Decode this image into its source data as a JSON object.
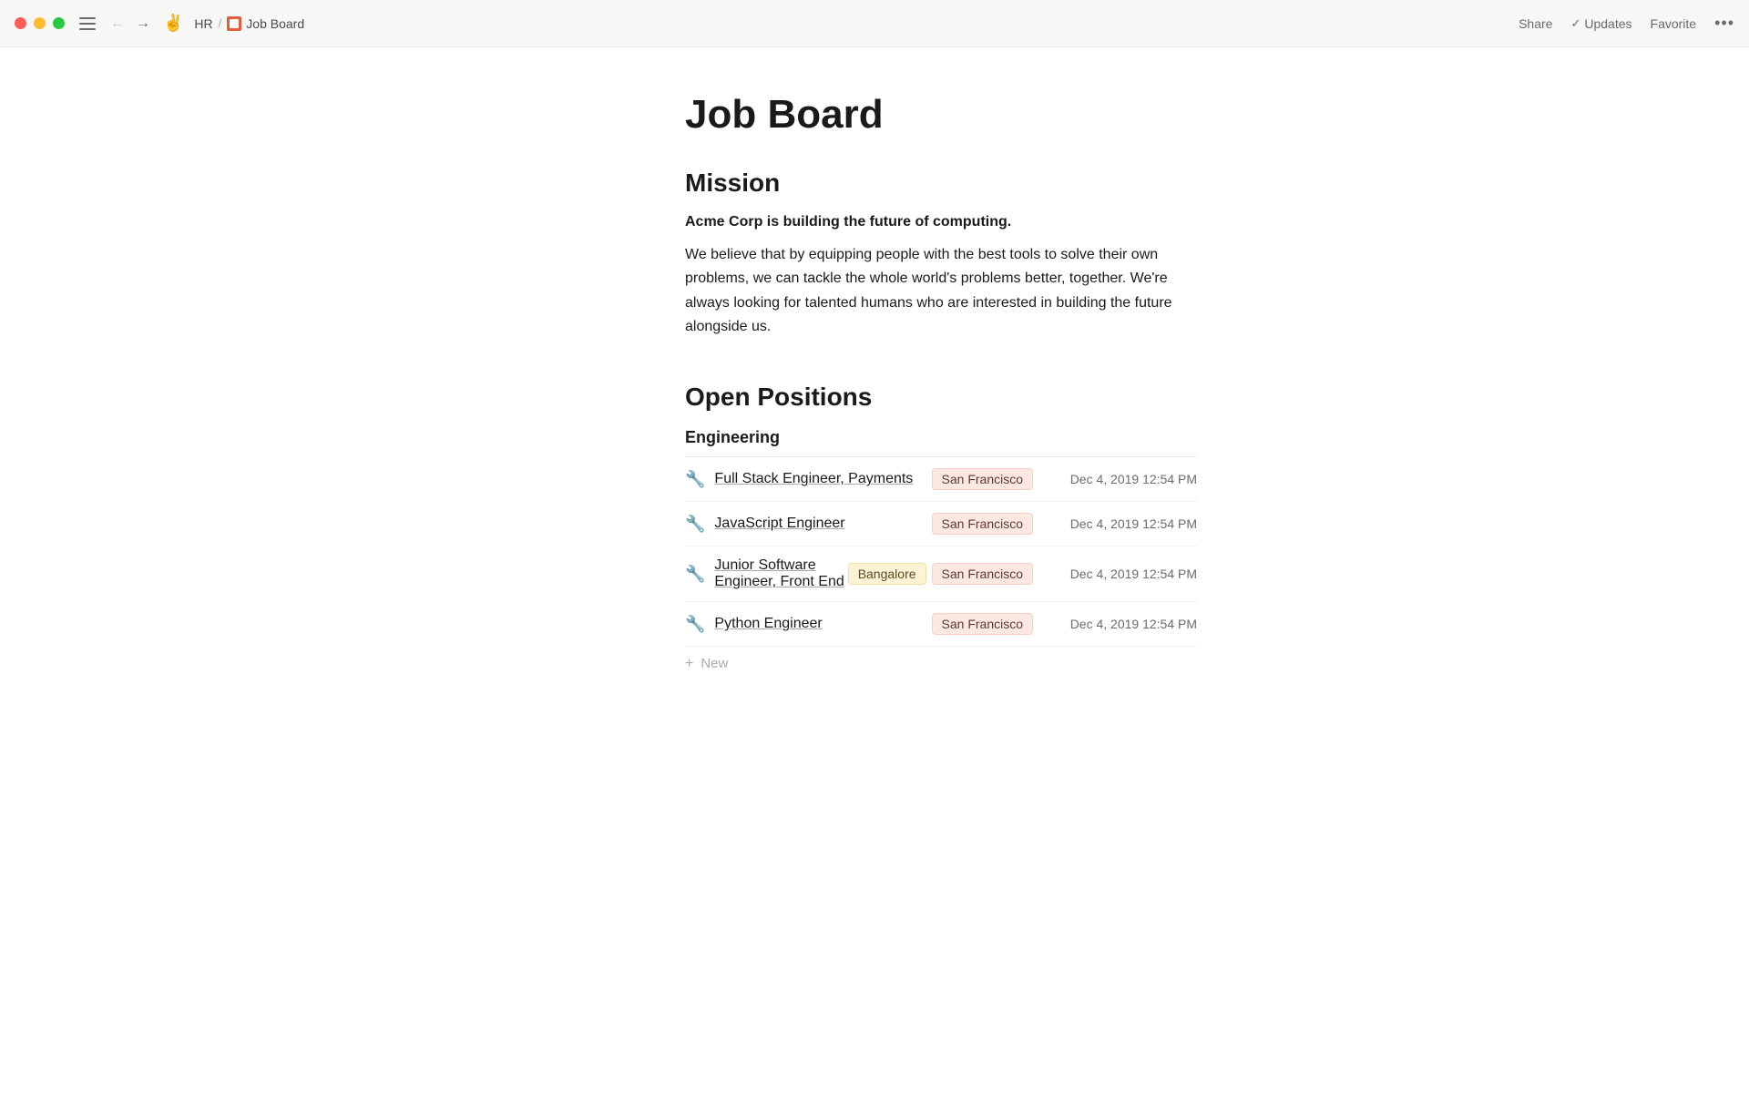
{
  "titlebar": {
    "emoji": "✌️",
    "breadcrumb_parent": "HR",
    "page_icon": "acme-icon",
    "page_name": "Job Board",
    "share_label": "Share",
    "updates_label": "Updates",
    "favorite_label": "Favorite"
  },
  "page": {
    "title": "Job Board",
    "mission_heading": "Mission",
    "mission_bold": "Acme Corp is building the future of computing.",
    "mission_body": "We believe that by equipping people with the best tools to solve their own problems, we can tackle the whole world's problems better, together. We're always looking for talented humans who are interested in building the future alongside us.",
    "open_positions_heading": "Open Positions",
    "engineering_heading": "Engineering",
    "new_label": "New"
  },
  "jobs": [
    {
      "icon": "🔧",
      "name": "Full Stack Engineer, Payments",
      "tags": [
        "San Francisco"
      ],
      "tag_styles": [
        "salmon"
      ],
      "date": "Dec 4, 2019 12:54 PM"
    },
    {
      "icon": "🔧",
      "name": "JavaScript Engineer",
      "tags": [
        "San Francisco"
      ],
      "tag_styles": [
        "salmon"
      ],
      "date": "Dec 4, 2019 12:54 PM"
    },
    {
      "icon": "🔧",
      "name": "Junior Software Engineer, Front End",
      "tags": [
        "Bangalore",
        "San Francisco"
      ],
      "tag_styles": [
        "yellow",
        "salmon"
      ],
      "date": "Dec 4, 2019 12:54 PM"
    },
    {
      "icon": "🔧",
      "name": "Python Engineer",
      "tags": [
        "San Francisco"
      ],
      "tag_styles": [
        "salmon"
      ],
      "date": "Dec 4, 2019 12:54 PM"
    }
  ]
}
